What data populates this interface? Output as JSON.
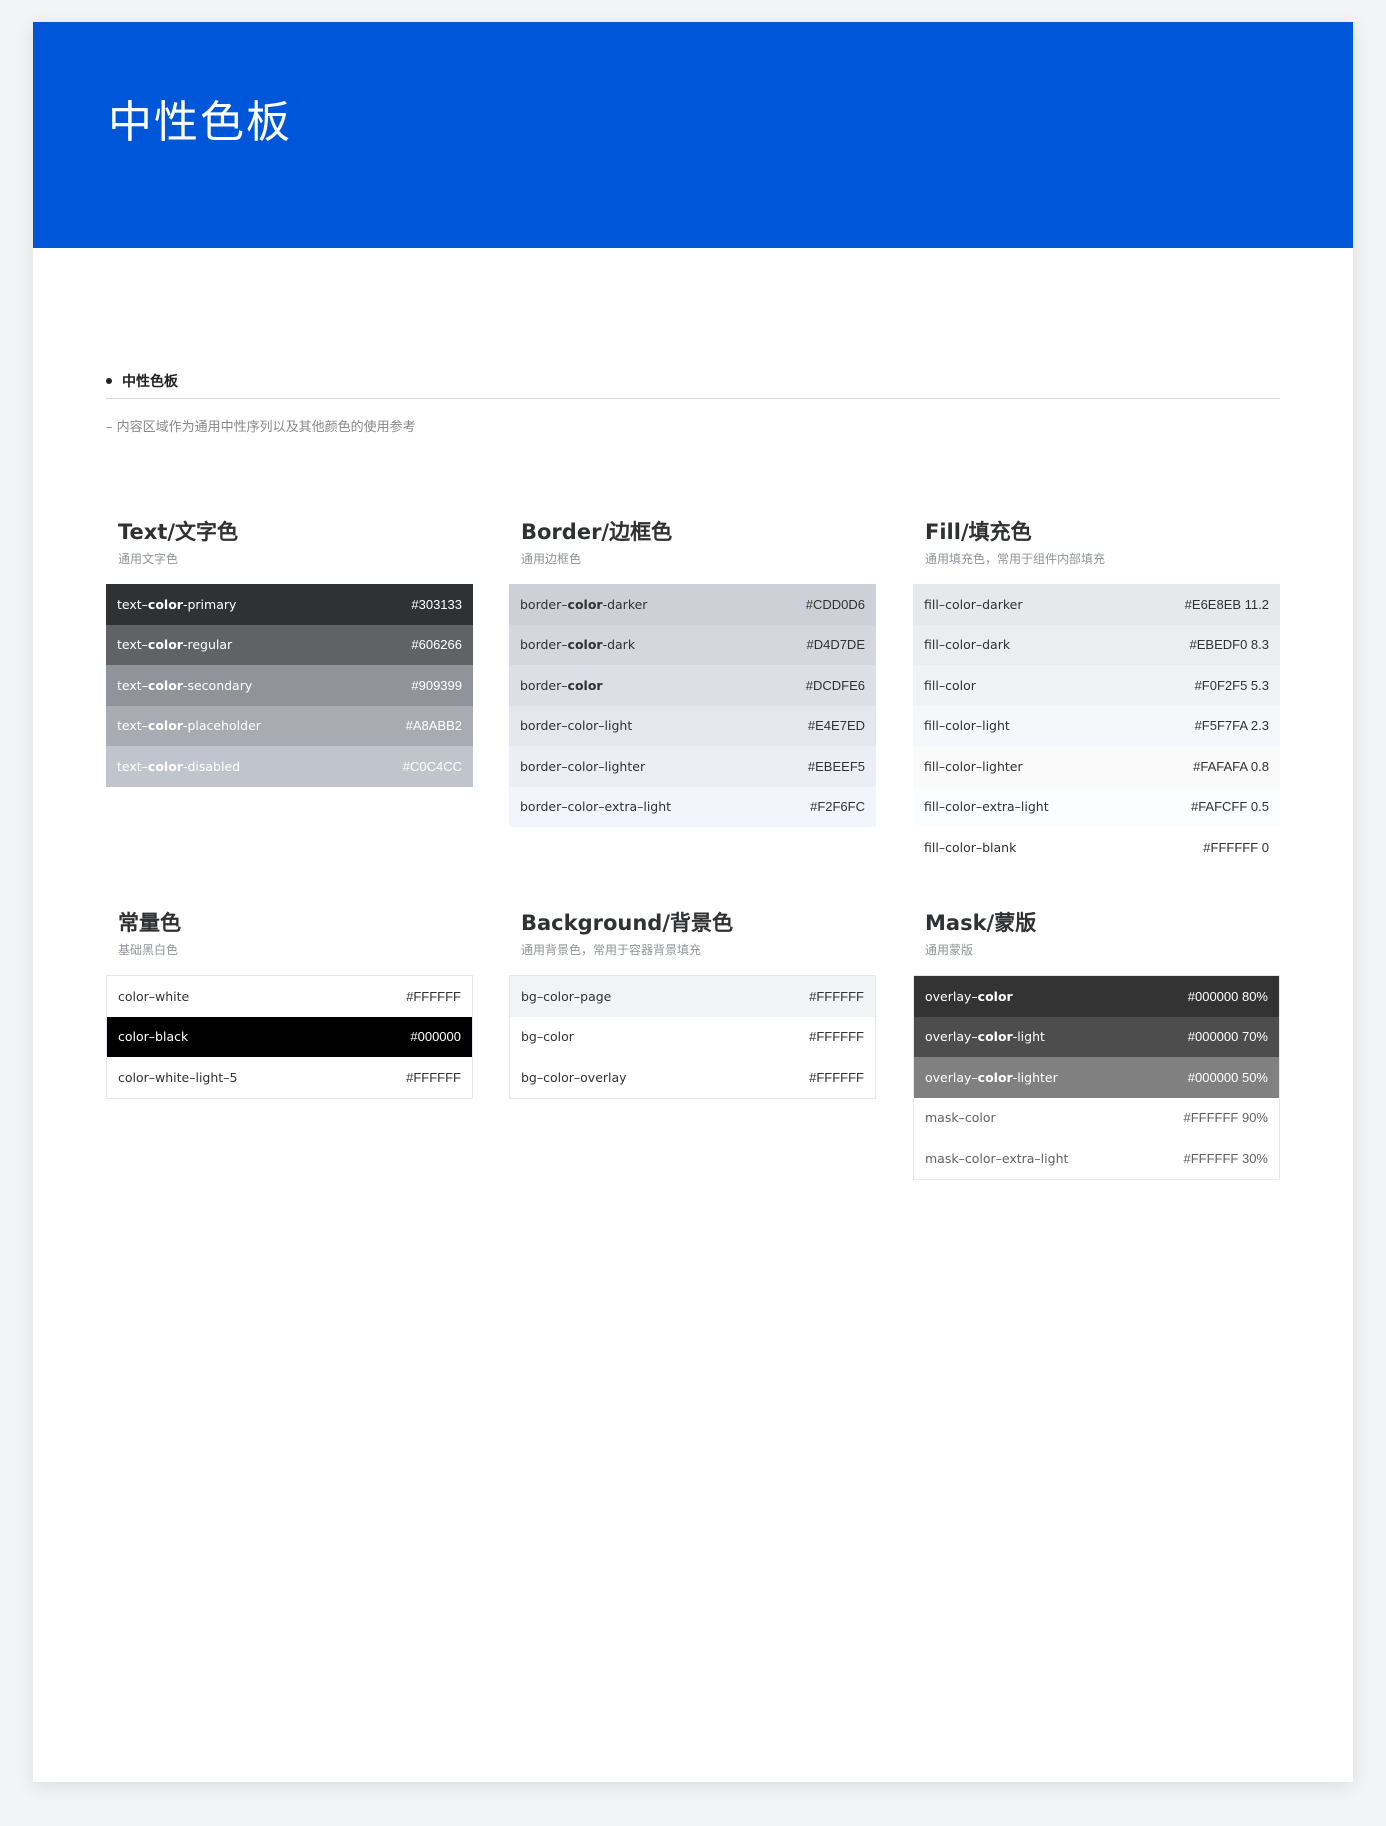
{
  "banner": {
    "title": "中性色板"
  },
  "section": {
    "label": "中性色板",
    "description": "– 内容区域作为通用中性序列以及其他颜色的使用参考"
  },
  "colors": {
    "brand_blue": "#0056D9"
  },
  "cards": [
    {
      "title": "Text/文字色",
      "subtitle": "通用文字色",
      "bordered": false,
      "items": [
        {
          "pre": "text–",
          "bold": "color",
          "post": "-primary",
          "hex": "#303133",
          "bg": "#303133",
          "fg": "#ffffff"
        },
        {
          "pre": "text–",
          "bold": "color",
          "post": "-regular",
          "hex": "#606266",
          "bg": "#606266",
          "fg": "#ffffff"
        },
        {
          "pre": "text–",
          "bold": "color",
          "post": "-secondary",
          "hex": "#909399",
          "bg": "#909399",
          "fg": "#ffffff"
        },
        {
          "pre": "text–",
          "bold": "color",
          "post": "-placeholder",
          "hex": "#A8ABB2",
          "bg": "#A8ABB2",
          "fg": "#ffffff"
        },
        {
          "pre": "text–",
          "bold": "color",
          "post": "-disabled",
          "hex": "#C0C4CC",
          "bg": "#C0C4CC",
          "fg": "#ffffff"
        }
      ]
    },
    {
      "title": "Border/边框色",
      "subtitle": "通用边框色",
      "bordered": false,
      "items": [
        {
          "pre": "border–",
          "bold": "color",
          "post": "-darker",
          "hex": "#CDD0D6",
          "bg": "#CDD0D6",
          "fg": "#303133"
        },
        {
          "pre": "border–",
          "bold": "color",
          "post": "-dark",
          "hex": "#D4D7DE",
          "bg": "#D4D7DE",
          "fg": "#303133"
        },
        {
          "pre": "border–",
          "bold": "color",
          "post": "",
          "hex": "#DCDFE6",
          "bg": "#DCDFE6",
          "fg": "#303133"
        },
        {
          "pre": "border–color–light",
          "bold": "",
          "post": "",
          "hex": "#E4E7ED",
          "bg": "#E4E7ED",
          "fg": "#303133"
        },
        {
          "pre": "border–color–lighter",
          "bold": "",
          "post": "",
          "hex": "#EBEEF5",
          "bg": "#EBEEF5",
          "fg": "#303133"
        },
        {
          "pre": "border–color–extra–light",
          "bold": "",
          "post": "",
          "hex": "#F2F6FC",
          "bg": "#F2F6FC",
          "fg": "#303133"
        }
      ]
    },
    {
      "title": "Fill/填充色",
      "subtitle": "通用填充色，常用于组件内部填充",
      "bordered": false,
      "items": [
        {
          "pre": "fill–color–darker",
          "bold": "",
          "post": "",
          "hex": "#E6E8EB 11.2",
          "bg": "#E6E8EB",
          "fg": "#303133"
        },
        {
          "pre": "fill–color–dark",
          "bold": "",
          "post": "",
          "hex": "#EBEDF0 8.3",
          "bg": "#EBEDF0",
          "fg": "#303133"
        },
        {
          "pre": "fill–color",
          "bold": "",
          "post": "",
          "hex": "#F0F2F5 5.3",
          "bg": "#F0F2F5",
          "fg": "#303133"
        },
        {
          "pre": "fill–color–light",
          "bold": "",
          "post": "",
          "hex": "#F5F7FA 2.3",
          "bg": "#F5F7FA",
          "fg": "#303133"
        },
        {
          "pre": "fill–color–lighter",
          "bold": "",
          "post": "",
          "hex": "#FAFAFA 0.8",
          "bg": "#FAFAFA",
          "fg": "#303133"
        },
        {
          "pre": "fill–color–extra–light",
          "bold": "",
          "post": "",
          "hex": "#FAFCFF 0.5",
          "bg": "#FAFCFF",
          "fg": "#303133"
        },
        {
          "pre": "fill–color–blank",
          "bold": "",
          "post": "",
          "hex": "#FFFFFF 0",
          "bg": "#FFFFFF",
          "fg": "#303133"
        }
      ]
    },
    {
      "title": "常量色",
      "subtitle": "基础黑白色",
      "bordered": true,
      "items": [
        {
          "pre": "color–white",
          "bold": "",
          "post": "",
          "hex": "#FFFFFF",
          "bg": "#FFFFFF",
          "fg": "#303133"
        },
        {
          "pre": "color–black",
          "bold": "",
          "post": "",
          "hex": "#000000",
          "bg": "#000000",
          "fg": "#ffffff"
        },
        {
          "pre": "color–white–light–5",
          "bold": "",
          "post": "",
          "hex": "#FFFFFF",
          "bg": "#FFFFFF",
          "fg": "#303133"
        }
      ]
    },
    {
      "title": "Background/背景色",
      "subtitle": "通用背景色，常用于容器背景填充",
      "bordered": true,
      "items": [
        {
          "pre": "bg–color–page",
          "bold": "",
          "post": "",
          "hex": "#FFFFFF",
          "bg": "#F2F3F5",
          "fg": "#303133"
        },
        {
          "pre": "bg–color",
          "bold": "",
          "post": "",
          "hex": "#FFFFFF",
          "bg": "#FFFFFF",
          "fg": "#303133"
        },
        {
          "pre": "bg–color–overlay",
          "bold": "",
          "post": "",
          "hex": "#FFFFFF",
          "bg": "#FFFFFF",
          "fg": "#303133"
        }
      ]
    },
    {
      "title": "Mask/蒙版",
      "subtitle": "通用蒙版",
      "bordered": true,
      "items": [
        {
          "pre": "overlay–",
          "bold": "color",
          "post": "",
          "hex": "#000000 80%",
          "bg": "#333333",
          "fg": "#ffffff"
        },
        {
          "pre": "overlay–",
          "bold": "color",
          "post": "-light",
          "hex": "#000000 70%",
          "bg": "#4d4d4d",
          "fg": "#ffffff"
        },
        {
          "pre": "overlay–",
          "bold": "color",
          "post": "-lighter",
          "hex": "#000000 50%",
          "bg": "#808080",
          "fg": "#ffffff"
        },
        {
          "pre": "mask–color",
          "bold": "",
          "post": "",
          "hex": "#FFFFFF 90%",
          "bg": "#FFFFFF",
          "fg": "#606266"
        },
        {
          "pre": "mask–color–extra–light",
          "bold": "",
          "post": "",
          "hex": "#FFFFFF 30%",
          "bg": "#FFFFFF",
          "fg": "#606266"
        }
      ]
    }
  ]
}
